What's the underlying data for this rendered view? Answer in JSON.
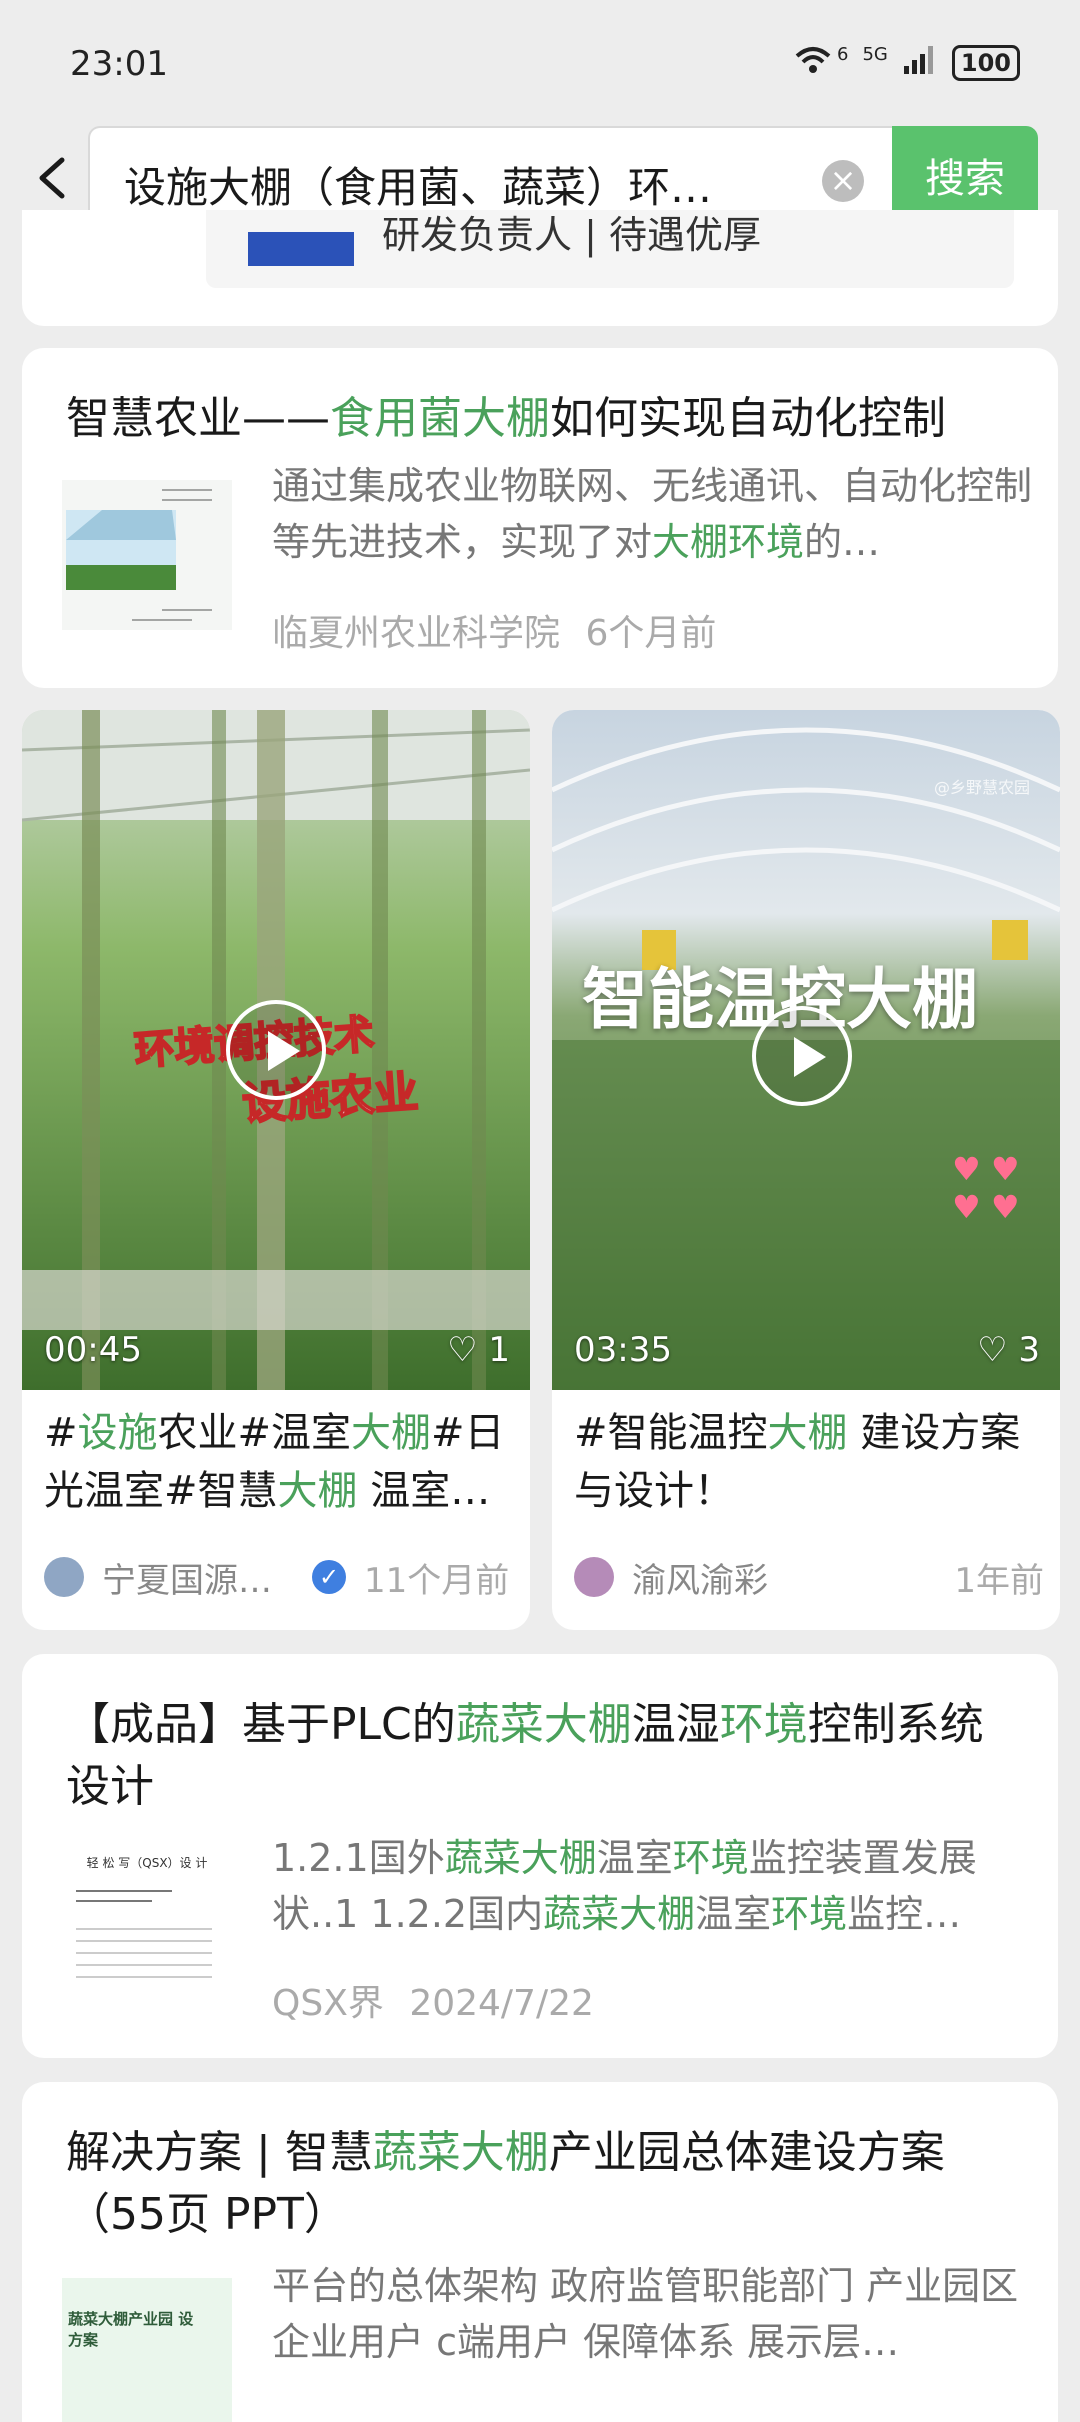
{
  "status": {
    "time": "23:01",
    "net1": "6",
    "net2": "5G",
    "battery": "100"
  },
  "search": {
    "query": "设施大棚（食用菌、蔬菜）环…",
    "button": "搜索"
  },
  "prev_card": {
    "text": "研发负责人 | 待遇优厚"
  },
  "articles": [
    {
      "title_parts": [
        "智慧农业——",
        "食用菌大棚",
        "如何实现自动化控制"
      ],
      "desc_parts": [
        "通过集成农业物联网、无线通讯、自动化控制等先进技术，实现了对",
        "大棚环境",
        "的…"
      ],
      "source": "临夏州农业科学院",
      "time": "6个月前"
    },
    {
      "title_parts": [
        "【成品】基于PLC的",
        "蔬菜大棚",
        "温湿",
        "环境",
        "控制系统设计"
      ],
      "desc_parts": [
        "1.2.1国外",
        "蔬菜大棚",
        "温室",
        "环境",
        "监控装置发展状..1 1.2.2国内",
        "蔬菜大棚",
        "温室",
        "环境",
        "监控…"
      ],
      "source": "QSX界",
      "time": "2024/7/22",
      "thumb_text": "轻 松 写（QSX）设 计"
    },
    {
      "title_parts": [
        "解决方案 | 智慧",
        "蔬菜大棚",
        "产业园总体建设方案（55页 PPT）"
      ],
      "desc_parts": [
        "平台的总体架构 政府监管职能部门 产业园区企业用户 c端用户 保障体系 展示层…"
      ],
      "thumb_text": "蔬菜大棚产业园 设方案"
    }
  ],
  "videos": [
    {
      "overlay1": "环境调控技术",
      "overlay2": "设施农业",
      "duration": "00:45",
      "likes": "1",
      "title_parts": [
        "#",
        "设施",
        "农业#温室",
        "大棚",
        "#日光温室#智慧",
        "大棚",
        " 温室…"
      ],
      "author": "宁夏国源…",
      "time": "11个月前"
    },
    {
      "overlay1": "智能温控大棚",
      "watermark": "@乡野慧农园",
      "duration": "03:35",
      "likes": "3",
      "title_parts": [
        "#智能温控",
        "大棚",
        " 建设方案与设计！"
      ],
      "author": "渝风渝彩",
      "time": "1年前"
    }
  ]
}
